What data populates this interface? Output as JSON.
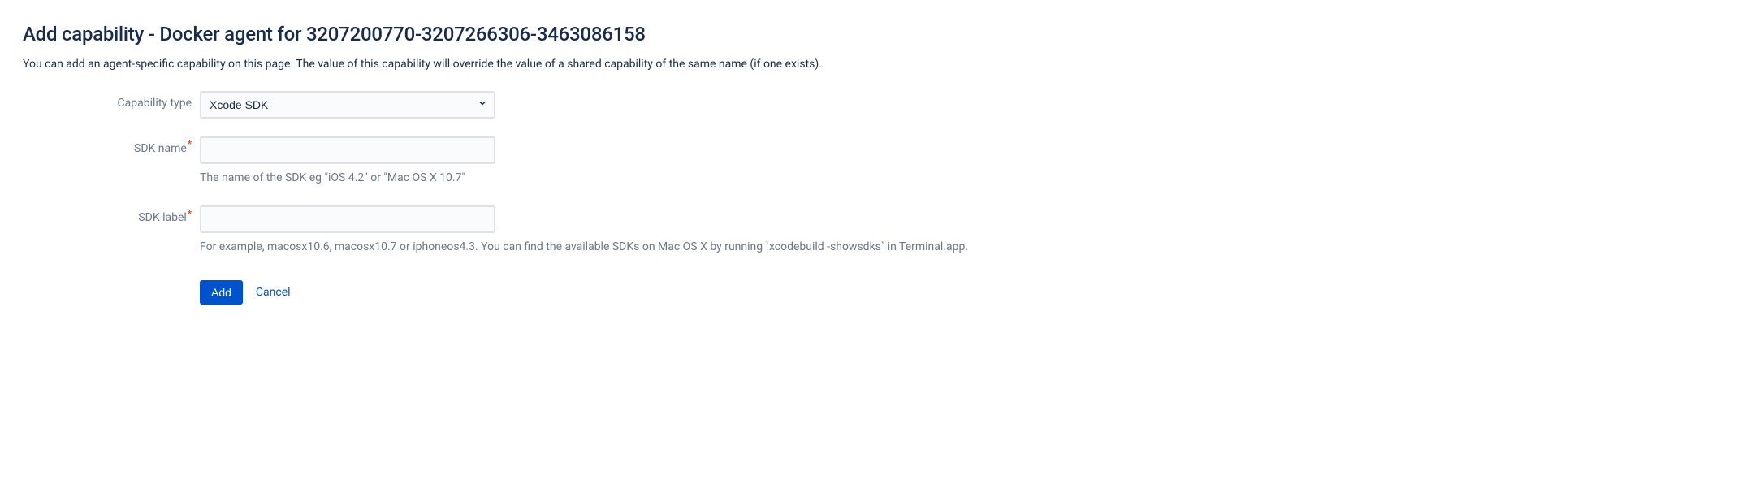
{
  "title": "Add capability - Docker agent for 3207200770-3207266306-3463086158",
  "description": "You can add an agent-specific capability on this page. The value of this capability will override the value of a shared capability of the same name (if one exists).",
  "form": {
    "capability_type": {
      "label": "Capability type",
      "selected": "Xcode SDK"
    },
    "sdk_name": {
      "label": "SDK name",
      "value": "",
      "help": "The name of the SDK eg \"iOS 4.2\" or \"Mac OS X 10.7\""
    },
    "sdk_label": {
      "label": "SDK label",
      "value": "",
      "help": "For example, macosx10.6, macosx10.7 or iphoneos4.3. You can find the available SDKs on Mac OS X by running `xcodebuild -showsdks` in Terminal.app."
    },
    "buttons": {
      "add": "Add",
      "cancel": "Cancel"
    }
  }
}
